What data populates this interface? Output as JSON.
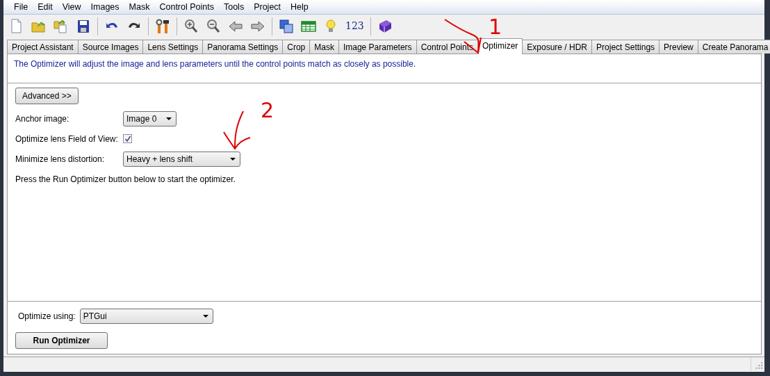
{
  "menu": [
    "File",
    "Edit",
    "View",
    "Images",
    "Mask",
    "Control Points",
    "Tools",
    "Project",
    "Help"
  ],
  "toolbar": {
    "number_button": "123"
  },
  "tabs": [
    {
      "label": "Project Assistant",
      "selected": false
    },
    {
      "label": "Source Images",
      "selected": false
    },
    {
      "label": "Lens Settings",
      "selected": false
    },
    {
      "label": "Panorama Settings",
      "selected": false
    },
    {
      "label": "Crop",
      "selected": false
    },
    {
      "label": "Mask",
      "selected": false
    },
    {
      "label": "Image Parameters",
      "selected": false
    },
    {
      "label": "Control Points",
      "selected": false
    },
    {
      "label": "Optimizer",
      "selected": true
    },
    {
      "label": "Exposure / HDR",
      "selected": false
    },
    {
      "label": "Project Settings",
      "selected": false
    },
    {
      "label": "Preview",
      "selected": false
    },
    {
      "label": "Create Panorama",
      "selected": false
    }
  ],
  "description": "The Optimizer will adjust the image and lens parameters until the control points match as closely as possible.",
  "advanced_button": "Advanced >>",
  "anchor": {
    "label": "Anchor image:",
    "value": "Image 0"
  },
  "fov": {
    "label": "Optimize lens Field of View:",
    "checked": true
  },
  "distortion": {
    "label": "Minimize lens distortion:",
    "value": "Heavy + lens shift"
  },
  "instruction": "Press the Run Optimizer button below to start the optimizer.",
  "optimize_using": {
    "label": "Optimize using:",
    "value": "PTGui"
  },
  "run_button": "Run Optimizer",
  "annotations": [
    {
      "text": "1"
    },
    {
      "text": "2"
    }
  ]
}
